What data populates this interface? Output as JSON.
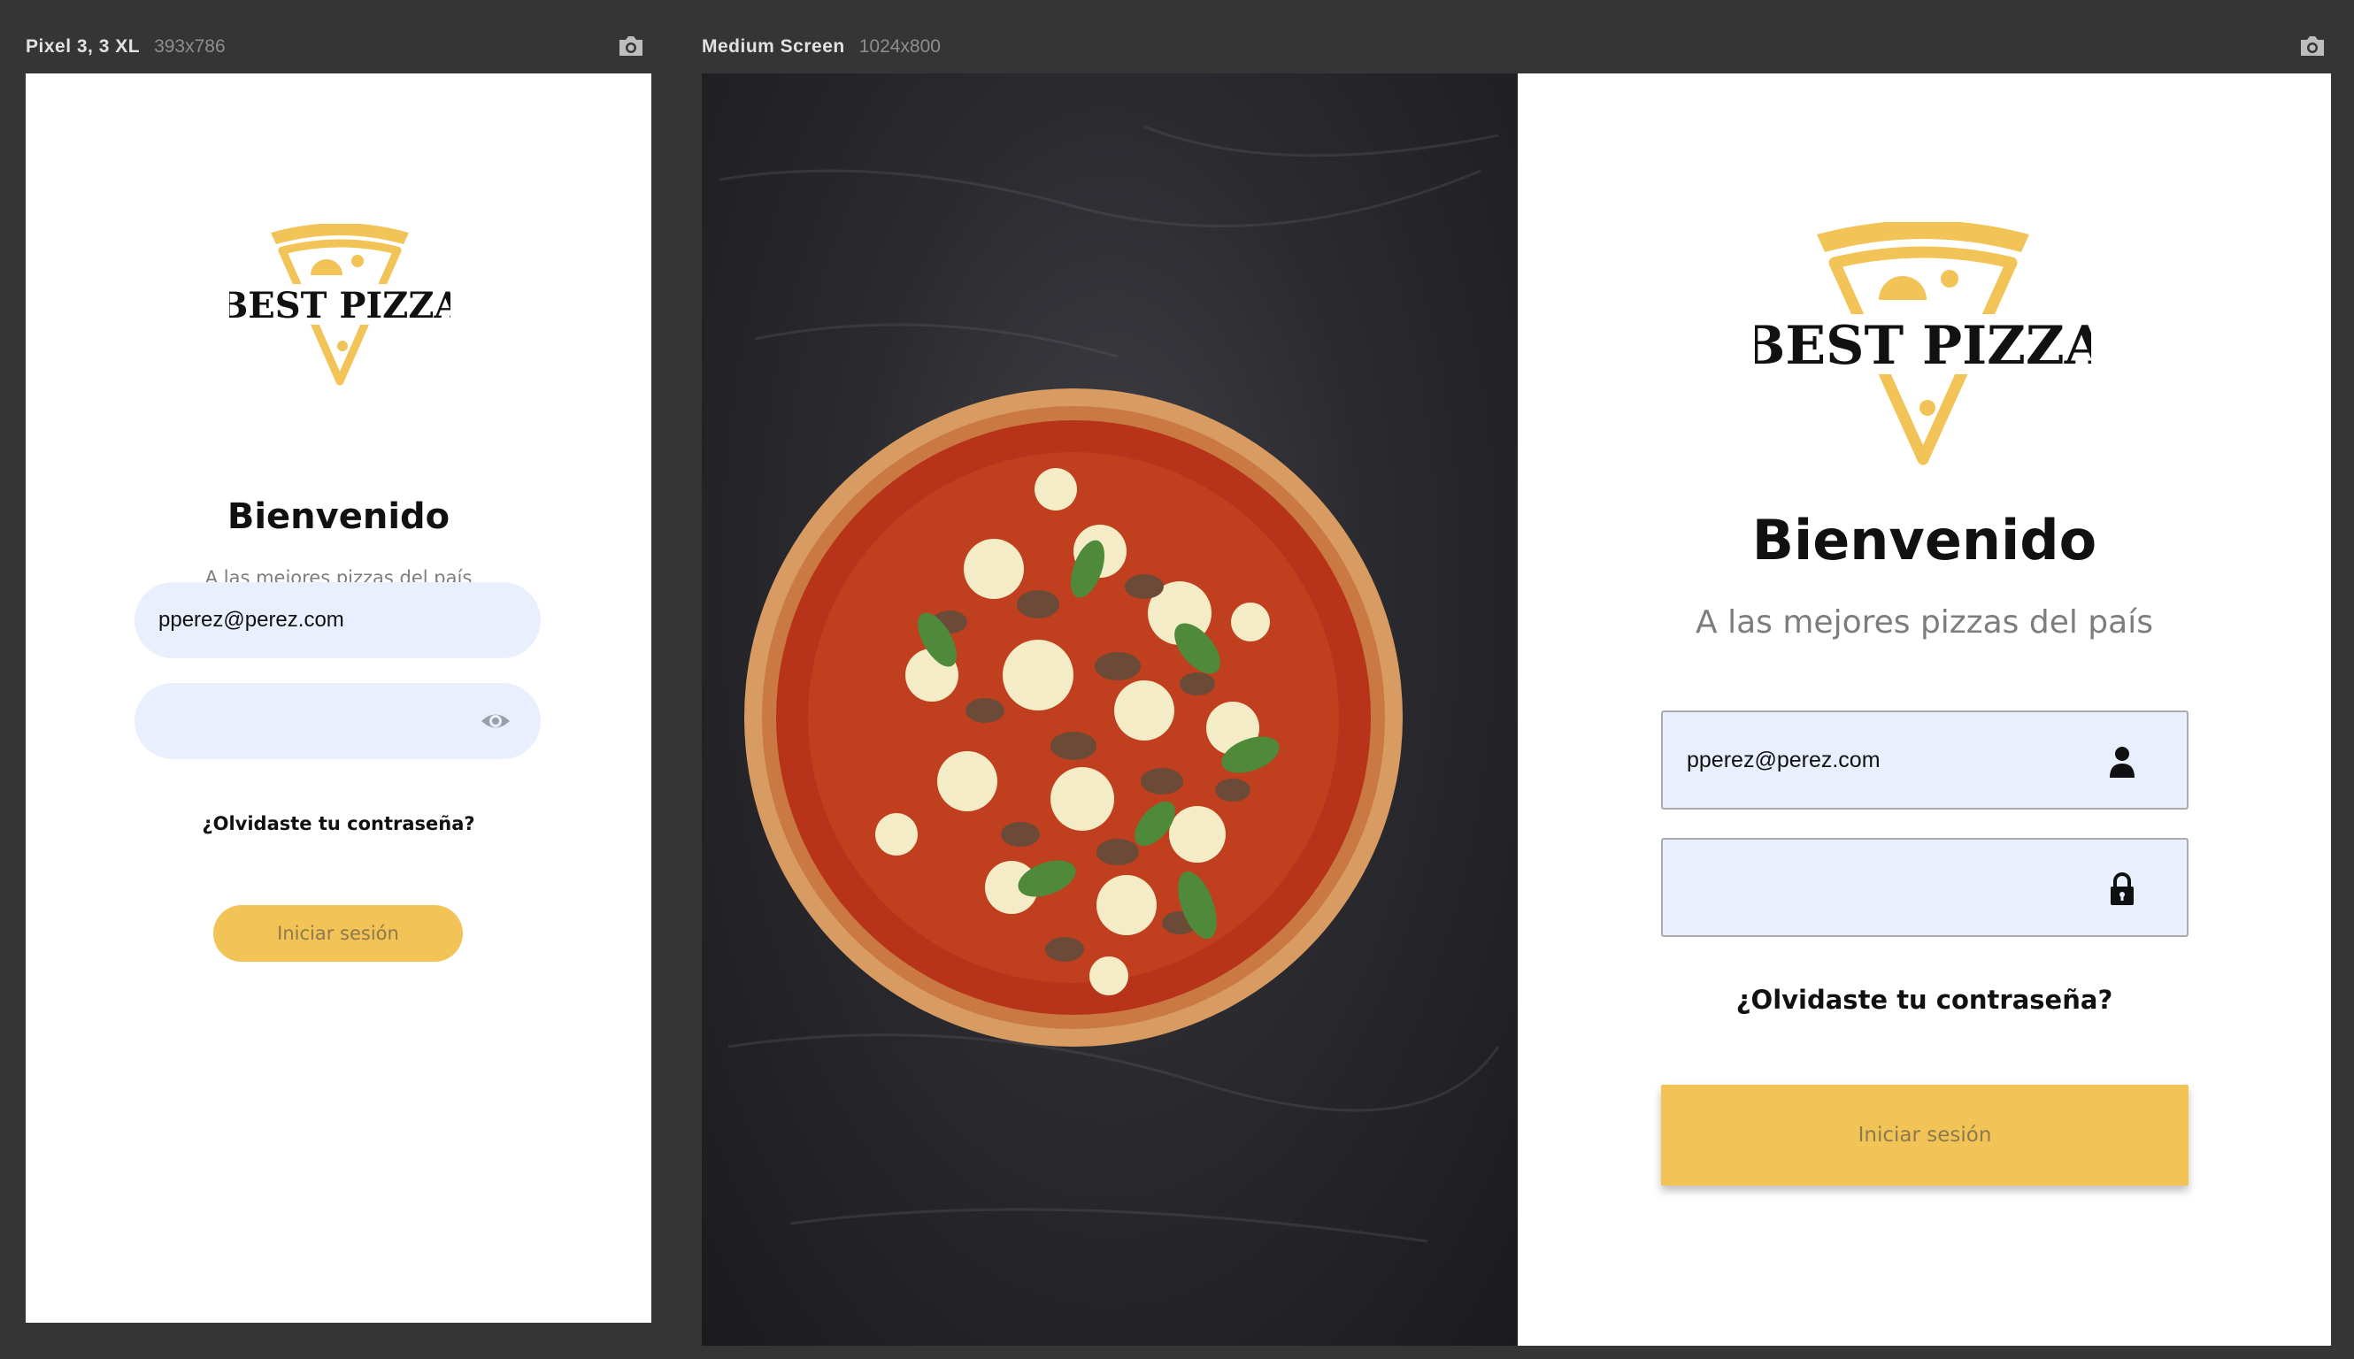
{
  "colors": {
    "background": "#353535",
    "accent": "#f2c357",
    "input_fill": "#e9effd",
    "muted_text": "#7d7d7d"
  },
  "phone": {
    "device_name": "Pixel 3, 3 XL",
    "device_dims": "393x786",
    "logo_text": "BEST PIZZA",
    "welcome": "Bienvenido",
    "subtitle": "A las mejores pizzas del país",
    "email_value": "pperez@perez.com",
    "password_value": "",
    "forgot_label": "¿Olvidaste tu contraseña?",
    "login_label": "Iniciar sesión",
    "icons": [
      "camera-icon",
      "pizza-slice-icon",
      "eye-icon"
    ]
  },
  "tablet": {
    "device_name": "Medium Screen",
    "device_dims": "1024x800",
    "logo_text": "BEST PIZZA",
    "welcome": "Bienvenido",
    "subtitle": "A las mejores pizzas del país",
    "email_value": "pperez@perez.com",
    "password_value": "",
    "forgot_label": "¿Olvidaste tu contraseña?",
    "login_label": "Iniciar sesión",
    "icons": [
      "camera-icon",
      "pizza-photo",
      "pizza-slice-icon",
      "user-icon",
      "lock-icon"
    ]
  }
}
